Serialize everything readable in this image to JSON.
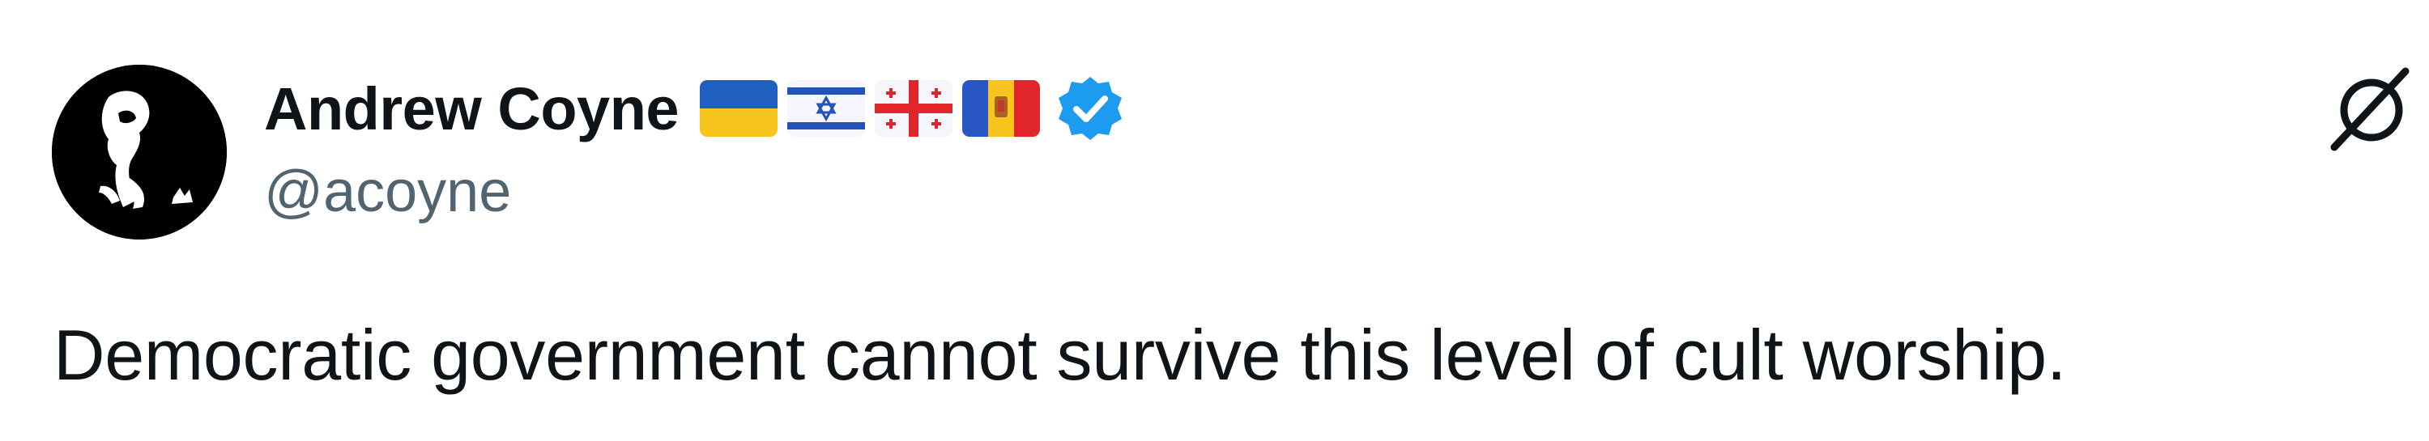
{
  "author": {
    "display_name": "Andrew Coyne",
    "handle": "@acoyne",
    "avatar_icon": "portrait-silhouette-avatar",
    "verified": true,
    "verified_badge_color": "#1d9bf0",
    "flags": [
      {
        "icon": "flag-ukraine-icon",
        "country": "Ukraine"
      },
      {
        "icon": "flag-israel-icon",
        "country": "Israel"
      },
      {
        "icon": "flag-georgia-icon",
        "country": "Georgia"
      },
      {
        "icon": "flag-moldova-icon",
        "country": "Moldova"
      }
    ]
  },
  "tweet": {
    "text": "Democratic government cannot survive this level of cult worship."
  },
  "header": {
    "logo_icon": "null-symbol-icon"
  },
  "colors": {
    "text_primary": "#0f1419",
    "text_secondary": "#536471",
    "background": "#ffffff"
  }
}
